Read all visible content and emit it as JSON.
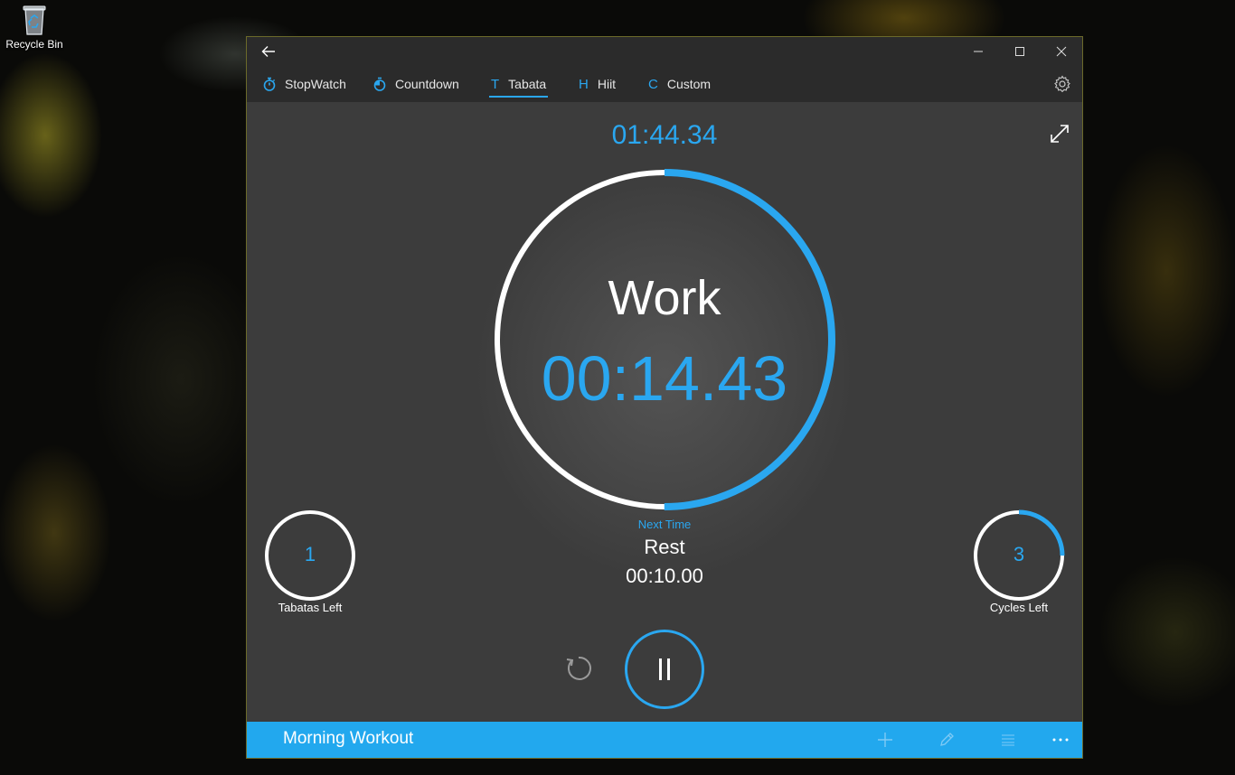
{
  "desktop": {
    "recycle_bin_label": "Recycle Bin"
  },
  "window": {
    "tabs": [
      {
        "icon": "stopwatch-icon",
        "label": "StopWatch"
      },
      {
        "icon": "countdown-icon",
        "label": "Countdown"
      },
      {
        "icon_letter": "T",
        "label": "Tabata",
        "active": true
      },
      {
        "icon_letter": "H",
        "label": "Hiit"
      },
      {
        "icon_letter": "C",
        "label": "Custom"
      }
    ]
  },
  "timer": {
    "elapsed": "01:44.34",
    "phase": "Work",
    "phase_time": "00:14.43",
    "phase_progress": 0.5,
    "next_caption": "Next Time",
    "next_name": "Rest",
    "next_time": "00:10.00",
    "tabatas_left": {
      "value": "1",
      "label": "Tabatas Left",
      "progress": 0
    },
    "cycles_left": {
      "value": "3",
      "label": "Cycles Left",
      "progress": 0.25
    }
  },
  "bottom_bar": {
    "workout_name": "Morning Workout"
  },
  "colors": {
    "accent": "#2aa7f0",
    "ring_track": "#ffffff",
    "bottom_bar": "#22a8ee"
  }
}
